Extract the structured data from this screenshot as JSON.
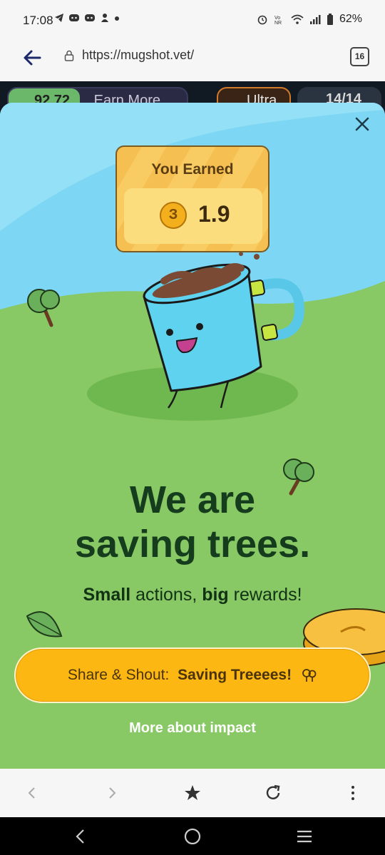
{
  "status_bar": {
    "time": "17:08",
    "battery": "62%"
  },
  "browser": {
    "url": "https://mugshot.vet/",
    "tab_count": "16"
  },
  "underlying_page": {
    "balance": "92.72",
    "earn_more": "Earn More",
    "ultra": "Ultra",
    "photo_count": "14/14"
  },
  "modal": {
    "earned_title": "You Earned",
    "coin_symbol": "З",
    "earned_amount": "1.9",
    "headline_line1": "We are",
    "headline_line2": "saving trees.",
    "sub_bold1": "Small",
    "sub_mid": " actions, ",
    "sub_bold2": "big",
    "sub_end": " rewards!",
    "share_prefix": "Share & Shout: ",
    "share_bold": "Saving Treeees!",
    "more_link": "More about impact"
  },
  "colors": {
    "sky": "#7dd6f3",
    "grass": "#88c865",
    "share_button": "#fcb713",
    "headline": "#153d1d"
  }
}
